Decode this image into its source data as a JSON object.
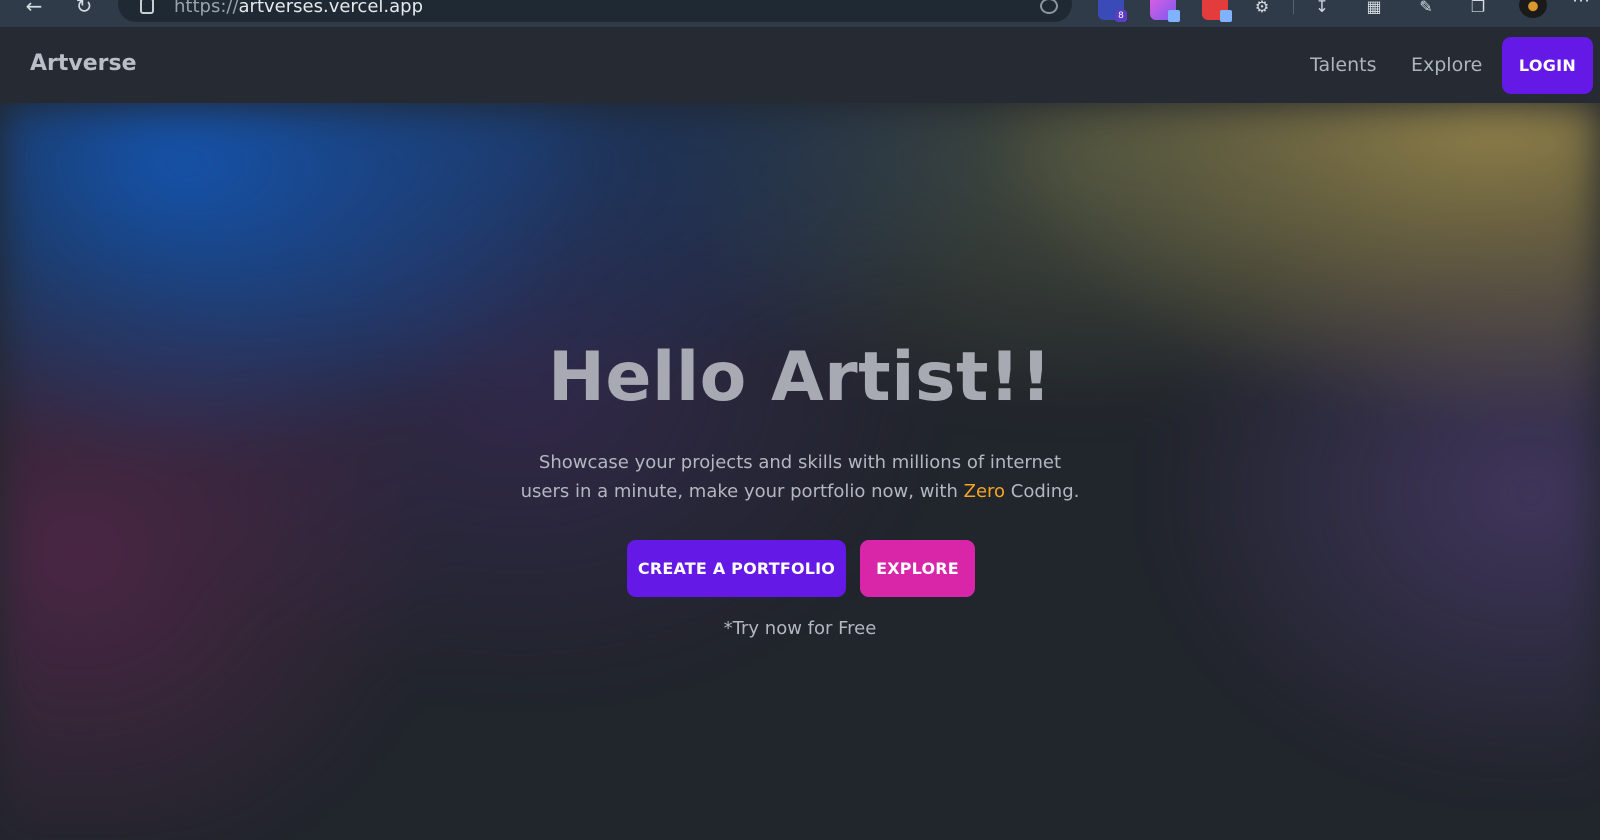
{
  "browser": {
    "url_scheme": "https://",
    "url_host": "artverses.vercel.app",
    "extension_badge": "8",
    "icons": {
      "back": "arrow-left-icon",
      "reload": "reload-icon",
      "site_info": "site-info-icon",
      "download": "download-icon",
      "split": "split-screen-icon",
      "edit": "edit-icon",
      "tabs": "tabs-icon",
      "puzzle": "extensions-icon",
      "menu": "more-icon"
    }
  },
  "header": {
    "brand": "Artverse",
    "nav": [
      "Talents",
      "Explore"
    ],
    "login_label": "LOGIN"
  },
  "hero": {
    "title": "Hello Artist!!",
    "subtitle_line1": "Showcase your projects and skills with millions of internet",
    "subtitle_line2_start": "users in a minute, make your portfolio now, with ",
    "subtitle_accent": "Zero",
    "subtitle_line2_end": " Coding.",
    "create_label": "CREATE A PORTFOLIO",
    "explore_label": "EXPLORE",
    "note": "*Try now for Free"
  },
  "colors": {
    "primary": "#6419e6",
    "secondary": "#d926a9",
    "accent": "#f5a524",
    "background": "#21252c",
    "header": "#252a33"
  }
}
